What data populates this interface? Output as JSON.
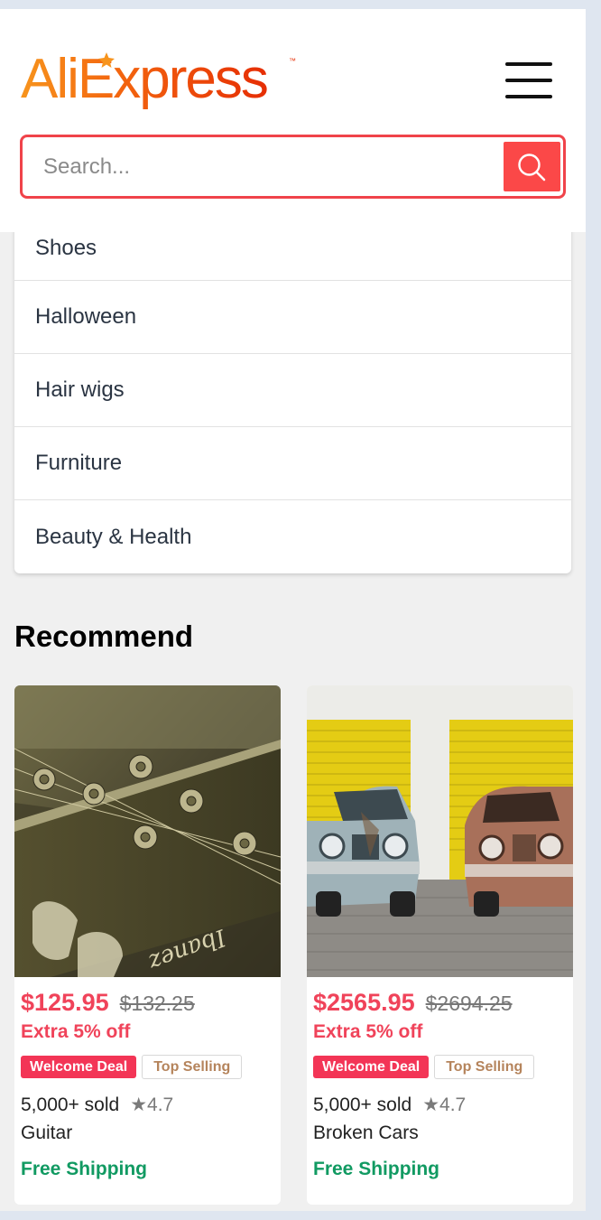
{
  "header": {
    "logo_text": "AliExpress",
    "search": {
      "placeholder": "Search...",
      "value": ""
    }
  },
  "categories": [
    "Shoes",
    "Halloween",
    "Hair wigs",
    "Furniture",
    "Beauty & Health"
  ],
  "recommend": {
    "title": "Recommend",
    "products": [
      {
        "price": "$125.95",
        "old_price": "$132.25",
        "extra": "Extra 5% off",
        "badge_deal": "Welcome Deal",
        "badge_top": "Top Selling",
        "sold": "5,000+ sold",
        "rating": "★4.7",
        "name": "Guitar",
        "shipping": "Free Shipping"
      },
      {
        "price": "$2565.95",
        "old_price": "$2694.25",
        "extra": "Extra 5% off",
        "badge_deal": "Welcome Deal",
        "badge_top": "Top Selling",
        "sold": "5,000+ sold",
        "rating": "★4.7",
        "name": "Broken Cars",
        "shipping": "Free Shipping"
      }
    ]
  },
  "colors": {
    "accent": "#fb4848",
    "price": "#f0435a",
    "shipping": "#119a62",
    "logo_orange": "#f7941d",
    "logo_red": "#e62e04"
  },
  "icons": {
    "menu": "hamburger-menu-icon",
    "search": "search-icon",
    "rating": "star-icon"
  }
}
